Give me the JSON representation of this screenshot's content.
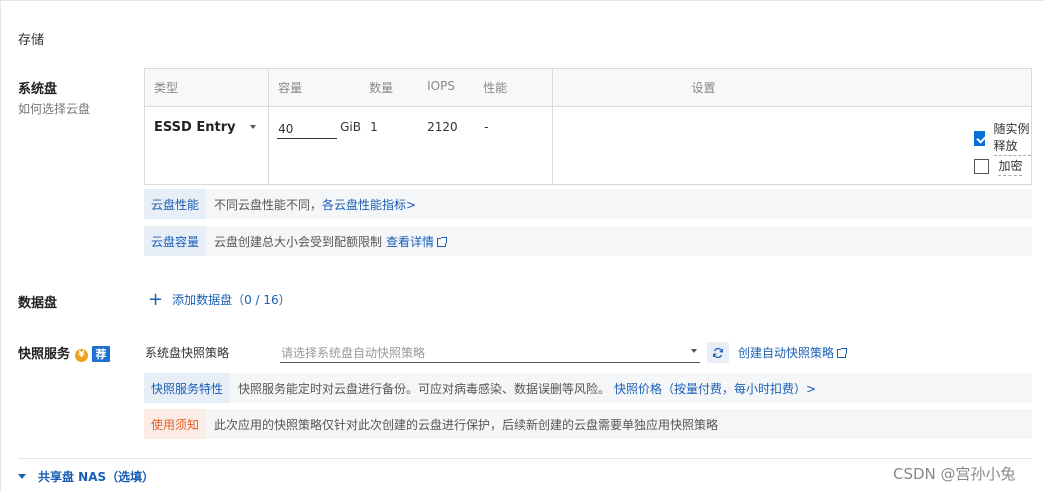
{
  "storage": {
    "title": "存储"
  },
  "system_disk": {
    "label": "系统盘",
    "help_link": "如何选择云盘",
    "columns": [
      "类型",
      "容量",
      "数量",
      "IOPS",
      "性能",
      "设置"
    ],
    "type_value": "ESSD Entry",
    "capacity_value": "40",
    "capacity_unit": "GiB",
    "count": "1",
    "iops": "2120",
    "performance": "-",
    "release_with_instance": {
      "label": "随实例释放",
      "checked": true
    },
    "encrypt": {
      "label": "加密",
      "checked": false
    },
    "info_performance": {
      "tag": "云盘性能",
      "text": "不同云盘性能不同，",
      "link": "各云盘性能指标>"
    },
    "info_capacity": {
      "tag": "云盘容量",
      "text": "云盘创建总大小会受到配额限制",
      "link": "查看详情"
    }
  },
  "data_disk": {
    "label": "数据盘",
    "add_label": "添加数据盘（0 / 16）"
  },
  "snapshot": {
    "label": "快照服务",
    "yuan_badge": "¥",
    "recommend_badge": "荐",
    "policy_label": "系统盘快照策略",
    "policy_placeholder": "请选择系统盘自动快照策略",
    "create_link": "创建自动快照策略",
    "feature": {
      "tag": "快照服务特性",
      "text": "快照服务能定时对云盘进行备份。可应对病毒感染、数据误删等风险。",
      "link": "快照价格（按量付费，每小时扣费）>"
    },
    "notice": {
      "tag": "使用须知",
      "text": "此次应用的快照策略仅针对此次创建的云盘进行保护，后续新创建的云盘需要单独应用快照策略"
    }
  },
  "nas": {
    "label": "共享盘 NAS（选填）"
  },
  "watermark": "CSDN @宫孙小兔",
  "colors": {
    "link": "#1a5fb4",
    "checkbox": "#0a6fd9",
    "warn": "#e0602a",
    "badge_yuan": "#f0a020",
    "badge_recommend": "#1a6fd0"
  }
}
